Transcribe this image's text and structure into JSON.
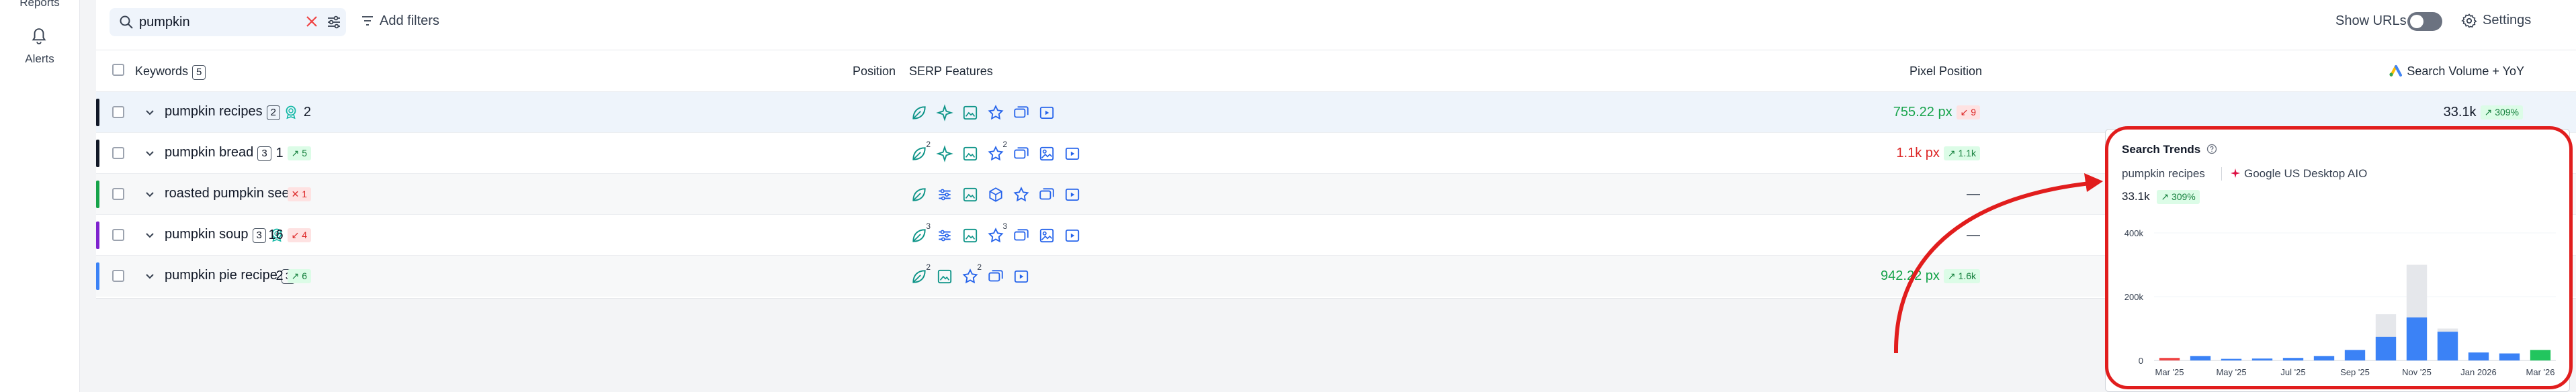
{
  "sidebar": {
    "reports_label": "Reports",
    "alerts_label": "Alerts"
  },
  "toolbar": {
    "search_value": "pumpkin",
    "add_filters_label": "Add filters",
    "show_urls_label": "Show URLs",
    "show_urls_on": false,
    "settings_label": "Settings"
  },
  "table": {
    "headers": {
      "keywords": "Keywords",
      "keywords_count": "5",
      "position": "Position",
      "serp": "SERP Features",
      "pixel": "Pixel Position",
      "volume": "Search Volume + YoY"
    },
    "rows": [
      {
        "keyword": "pumpkin recipes",
        "count": "2",
        "award": true,
        "color": "#111827",
        "highlight": true,
        "position": "2",
        "pos_change": "",
        "pos_dir": "",
        "serp": [
          {
            "icon": "leaf-icon",
            "sup": ""
          },
          {
            "icon": "sparkle-icon",
            "sup": ""
          },
          {
            "icon": "image-icon",
            "sup": ""
          },
          {
            "icon": "star-icon",
            "sup": ""
          },
          {
            "icon": "cards-icon",
            "sup": ""
          },
          {
            "icon": "video-icon",
            "sup": ""
          }
        ],
        "pixel": "755.22 px",
        "pixel_color": "green",
        "pixel_change": "9",
        "pixel_dir": "down",
        "volume": "33.1k",
        "yoy": "309%"
      },
      {
        "keyword": "pumpkin bread",
        "count": "3",
        "award": false,
        "color": "#111827",
        "highlight": false,
        "position": "1",
        "pos_change": "5",
        "pos_dir": "up",
        "serp": [
          {
            "icon": "leaf-icon",
            "sup": "2"
          },
          {
            "icon": "sparkle-icon",
            "sup": ""
          },
          {
            "icon": "image-icon",
            "sup": ""
          },
          {
            "icon": "star-icon",
            "sup": "2"
          },
          {
            "icon": "cards-icon",
            "sup": ""
          },
          {
            "icon": "photo-icon",
            "sup": ""
          },
          {
            "icon": "video-icon",
            "sup": ""
          }
        ],
        "pixel": "1.1k px",
        "pixel_color": "red",
        "pixel_change": "1.1k",
        "pixel_dir": "up",
        "volume": "",
        "yoy": ""
      },
      {
        "keyword": "roasted pumpkin seeds",
        "count": "",
        "award": false,
        "color": "#16a34a",
        "highlight": false,
        "alt": true,
        "position": "",
        "pos_change": "1",
        "pos_dir": "lost",
        "serp": [
          {
            "icon": "leaf-icon",
            "sup": ""
          },
          {
            "icon": "sliders-icon",
            "sup": ""
          },
          {
            "icon": "image-icon",
            "sup": ""
          },
          {
            "icon": "cube-icon",
            "sup": ""
          },
          {
            "icon": "star-icon",
            "sup": ""
          },
          {
            "icon": "cards-icon",
            "sup": ""
          },
          {
            "icon": "video-icon",
            "sup": ""
          }
        ],
        "pixel": "—",
        "pixel_color": "dash",
        "pixel_change": "",
        "pixel_dir": "",
        "volume": "",
        "yoy": ""
      },
      {
        "keyword": "pumpkin soup",
        "count": "3",
        "award": true,
        "color": "#7e22ce",
        "highlight": false,
        "position": "16",
        "pos_change": "4",
        "pos_dir": "down",
        "serp": [
          {
            "icon": "leaf-icon",
            "sup": "3"
          },
          {
            "icon": "sliders-icon",
            "sup": ""
          },
          {
            "icon": "image-icon",
            "sup": ""
          },
          {
            "icon": "star-icon",
            "sup": "3"
          },
          {
            "icon": "cards-icon",
            "sup": ""
          },
          {
            "icon": "photo-icon",
            "sup": ""
          },
          {
            "icon": "video-icon",
            "sup": ""
          }
        ],
        "pixel": "—",
        "pixel_color": "dash",
        "pixel_change": "",
        "pixel_dir": "",
        "volume": "",
        "yoy": ""
      },
      {
        "keyword": "pumpkin pie recipe",
        "count": "3",
        "award": true,
        "color": "#3b82f6",
        "highlight": false,
        "alt": true,
        "position": "2",
        "pos_change": "6",
        "pos_dir": "up",
        "serp": [
          {
            "icon": "leaf-icon",
            "sup": "2"
          },
          {
            "icon": "image-icon",
            "sup": ""
          },
          {
            "icon": "star-icon",
            "sup": "2"
          },
          {
            "icon": "cards-icon",
            "sup": ""
          },
          {
            "icon": "video-icon",
            "sup": ""
          }
        ],
        "pixel": "942.22 px",
        "pixel_color": "green",
        "pixel_change": "1.6k",
        "pixel_dir": "up",
        "volume": "",
        "yoy": ""
      }
    ]
  },
  "trends": {
    "title": "Search Trends",
    "query": "pumpkin recipes",
    "engine": "Google US Desktop AIO",
    "volume": "33.1k",
    "yoy": "309%"
  },
  "chart_data": {
    "type": "bar",
    "y_ticks": [
      "0",
      "200k",
      "400k"
    ],
    "ylim": [
      0,
      400000
    ],
    "x_tick_labels": [
      "Mar '25",
      "May '25",
      "Jul '25",
      "Sep '25",
      "Nov '25",
      "Jan 2026",
      "Mar '26"
    ],
    "categories": [
      "Mar '25",
      "Apr '25",
      "May '25",
      "Jun '25",
      "Jul '25",
      "Aug '25",
      "Sep '25",
      "Oct '25",
      "Nov '25",
      "Dec '25",
      "Jan 2026",
      "Feb '26",
      "Mar '26"
    ],
    "series": [
      {
        "values": [
          8000,
          14000,
          5000,
          6000,
          8000,
          14000,
          33000,
          74000,
          135000,
          90000,
          25000,
          22000,
          33000
        ],
        "colors": [
          "#ef4444",
          "#3b82f6",
          "#3b82f6",
          "#3b82f6",
          "#3b82f6",
          "#3b82f6",
          "#3b82f6",
          "#3b82f6",
          "#3b82f6",
          "#3b82f6",
          "#3b82f6",
          "#3b82f6",
          "#22c55e"
        ]
      },
      {
        "values": [
          0,
          0,
          0,
          0,
          0,
          0,
          0,
          145000,
          300000,
          100000,
          0,
          0,
          0
        ],
        "color": "#e5e7eb"
      }
    ]
  }
}
